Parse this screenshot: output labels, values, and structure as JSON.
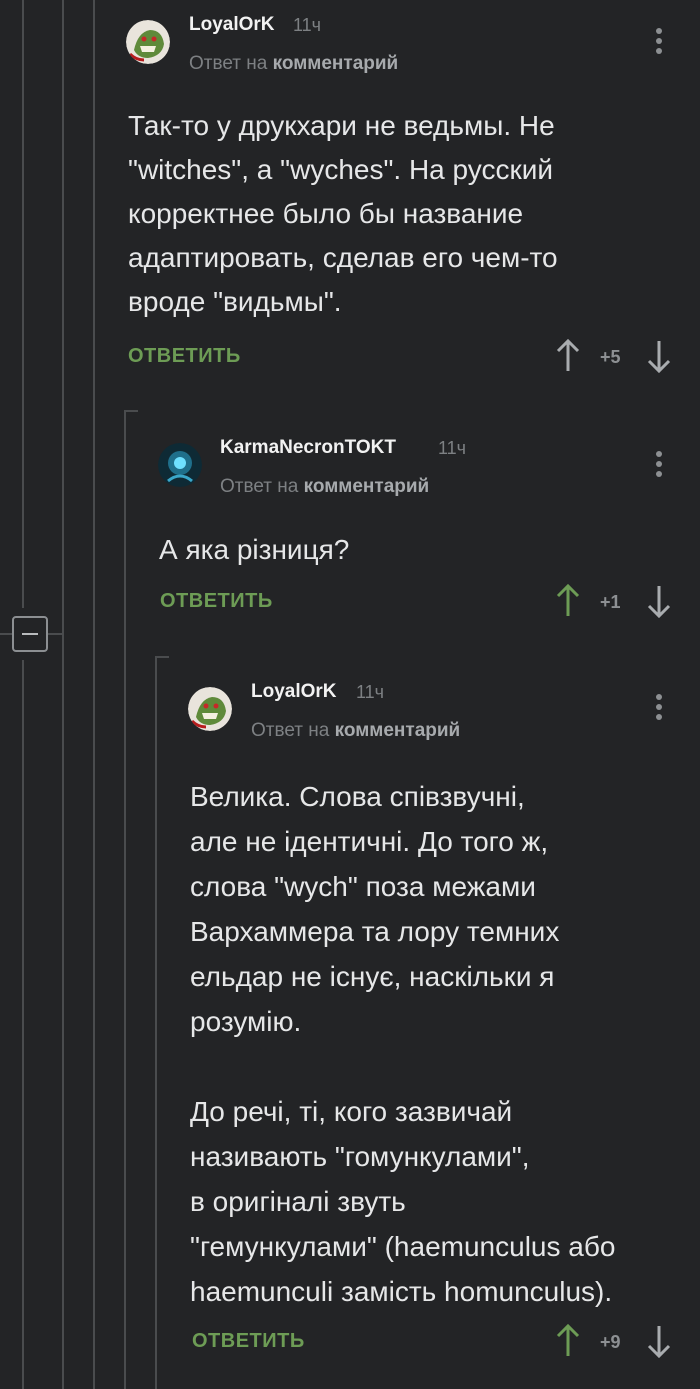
{
  "comments": [
    {
      "username": "LoyalOrK",
      "time": "11ч",
      "reply_prefix": "Ответ на",
      "reply_target": "комментарий",
      "text": "Так-то у друкхари не ведьмы. Не\n\"witches\", а \"wyches\". На русский\nкорректнее было бы название\nадаптировать, сделав его чем-то\nвроде \"видьмы\".",
      "reply_label": "ОТВЕТИТЬ",
      "score": "+5",
      "upvoted": false,
      "avatar": "goblin-avatar"
    },
    {
      "username": "KarmaNecronTOKT",
      "time": "11ч",
      "reply_prefix": "Ответ на",
      "reply_target": "комментарий",
      "text": "А яка різниця?",
      "reply_label": "ОТВЕТИТЬ",
      "score": "+1",
      "upvoted": true,
      "avatar": "necron-avatar"
    },
    {
      "username": "LoyalOrK",
      "time": "11ч",
      "reply_prefix": "Ответ на",
      "reply_target": "комментарий",
      "text": "Велика. Слова співзвучні,\nале не ідентичні. До того ж,\nслова \"wych\" поза межами\nВархаммера та лору темних\nельдар не існує, наскільки я\nрозумію.\n\nДо речі, ті, кого зазвичай\nназивають \"гомункулами\",\nв оригіналі звуть\n\"гемункулами\" (haemunculus або\nhaemunculi замість homunculus).",
      "reply_label": "ОТВЕТИТЬ",
      "score": "+9",
      "upvoted": true,
      "avatar": "goblin-avatar"
    }
  ],
  "colors": {
    "background": "#232426",
    "accent_green": "#6d9c55",
    "muted": "#7d8083"
  }
}
